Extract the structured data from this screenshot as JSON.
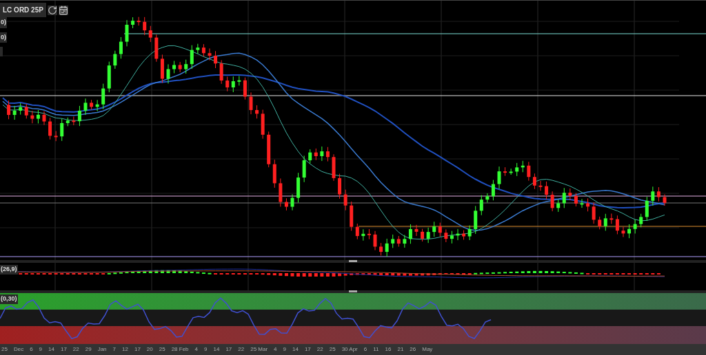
{
  "toolbar": {
    "instrument": "LC ORD 25P"
  },
  "main_panel": {
    "legend_rows": [
      "0)",
      "0)"
    ]
  },
  "macd_panel": {
    "label": "(26,9)"
  },
  "stochastic_panel": {
    "label": "(0,30)"
  },
  "x_axis": {
    "labels": [
      "25",
      "Dec",
      "6",
      "9",
      "14",
      "17",
      "22",
      "29",
      "Jan",
      "7",
      "12",
      "17",
      "20",
      "25",
      "28 Feb",
      "4",
      "9",
      "14",
      "17",
      "22",
      "25 Mar",
      "4",
      "9",
      "14",
      "17",
      "22",
      "25",
      "30 Apr",
      "6",
      "11",
      "16",
      "21",
      "26",
      "May"
    ]
  }
}
